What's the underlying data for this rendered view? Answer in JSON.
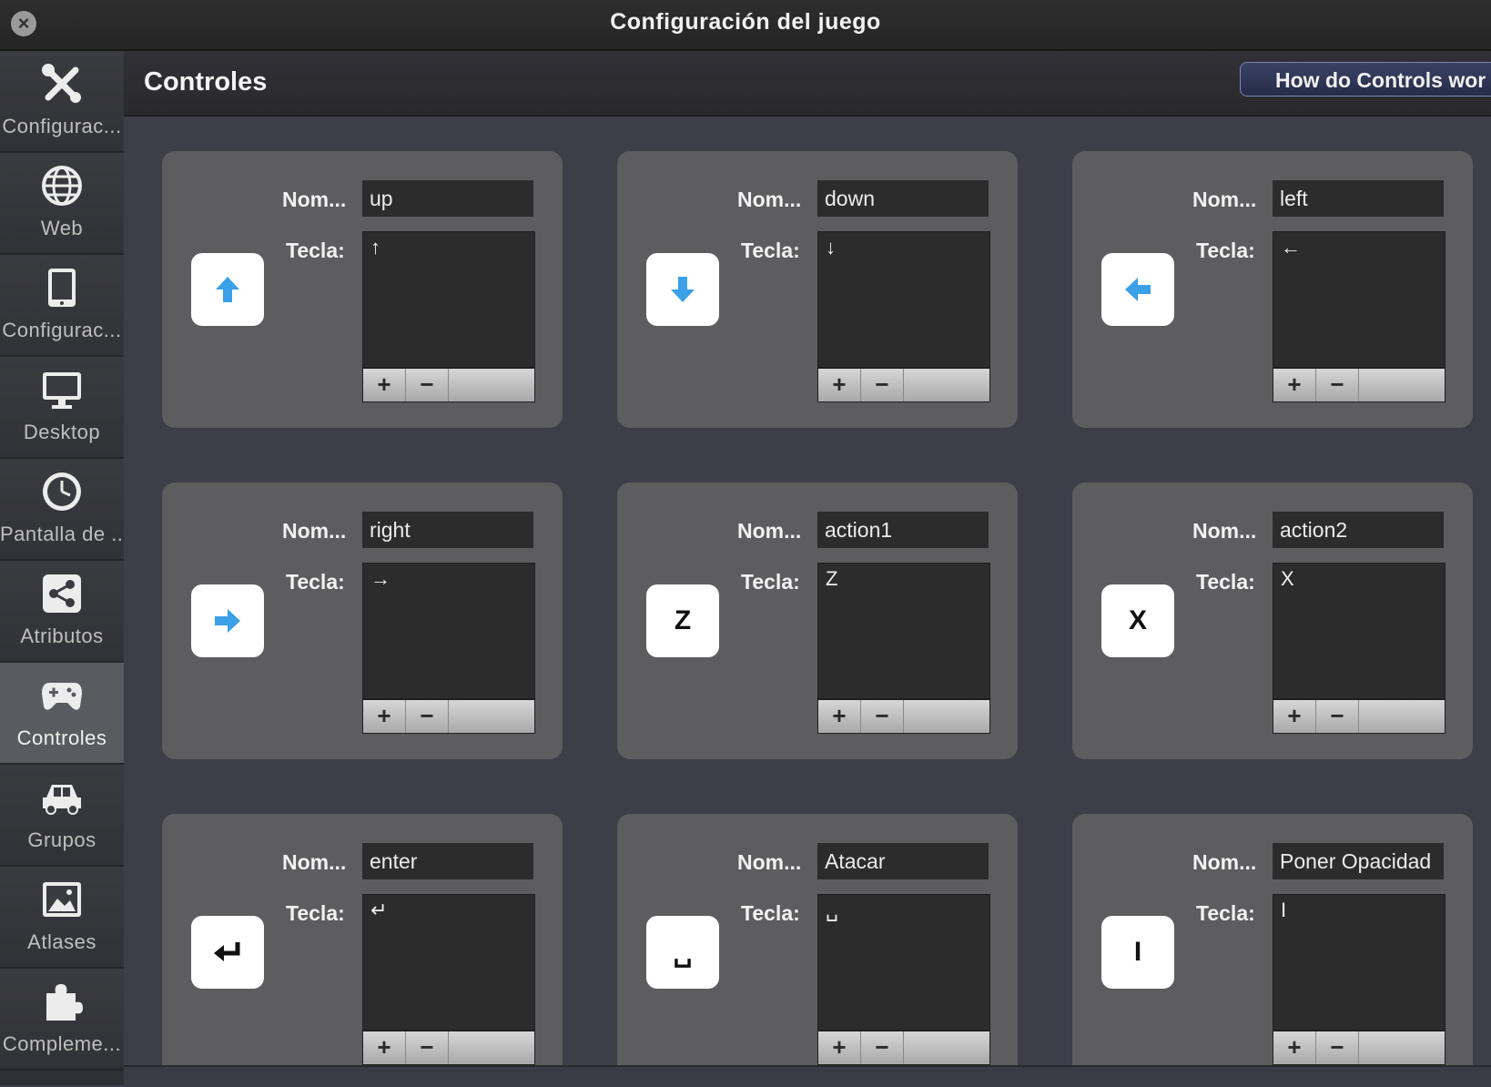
{
  "window": {
    "title": "Configuración del juego",
    "close_icon": "close-icon"
  },
  "sidebar": {
    "items": [
      {
        "label": "Configurac...",
        "icon": "tools-icon",
        "active": false
      },
      {
        "label": "Web",
        "icon": "globe-icon",
        "active": false
      },
      {
        "label": "Configurac...",
        "icon": "tablet-icon",
        "active": false
      },
      {
        "label": "Desktop",
        "icon": "monitor-icon",
        "active": false
      },
      {
        "label": "Pantalla de ...",
        "icon": "clock-icon",
        "active": false
      },
      {
        "label": "Atributos",
        "icon": "share-icon",
        "active": false
      },
      {
        "label": "Controles",
        "icon": "gamepad-icon",
        "active": true
      },
      {
        "label": "Grupos",
        "icon": "car-icon",
        "active": false
      },
      {
        "label": "Atlases",
        "icon": "picture-icon",
        "active": false
      },
      {
        "label": "Compleme...",
        "icon": "puzzle-icon",
        "active": false
      }
    ]
  },
  "header": {
    "title": "Controles",
    "help_button": "How do Controls wor"
  },
  "controls": {
    "name_label": "Nom...",
    "key_label": "Tecla:",
    "add_label": "+",
    "remove_label": "−",
    "items": [
      {
        "name": "up",
        "key": "↑",
        "icon": "arrow-up-icon"
      },
      {
        "name": "down",
        "key": "↓",
        "icon": "arrow-down-icon"
      },
      {
        "name": "left",
        "key": "←",
        "icon": "arrow-left-icon"
      },
      {
        "name": "right",
        "key": "→",
        "icon": "arrow-right-icon"
      },
      {
        "name": "action1",
        "key": "Z",
        "icon_text": "Z"
      },
      {
        "name": "action2",
        "key": "X",
        "icon_text": "X"
      },
      {
        "name": "enter",
        "key": "↵",
        "icon": "return-icon"
      },
      {
        "name": "Atacar",
        "key": "␣",
        "icon_text": "␣"
      },
      {
        "name": "Poner Opacidad",
        "key": "I",
        "icon_text": "I"
      }
    ]
  },
  "colors": {
    "arrow_blue": "#3aa0e8",
    "card_bg": "#5d5d5f",
    "content_bg": "#3d3e48"
  }
}
